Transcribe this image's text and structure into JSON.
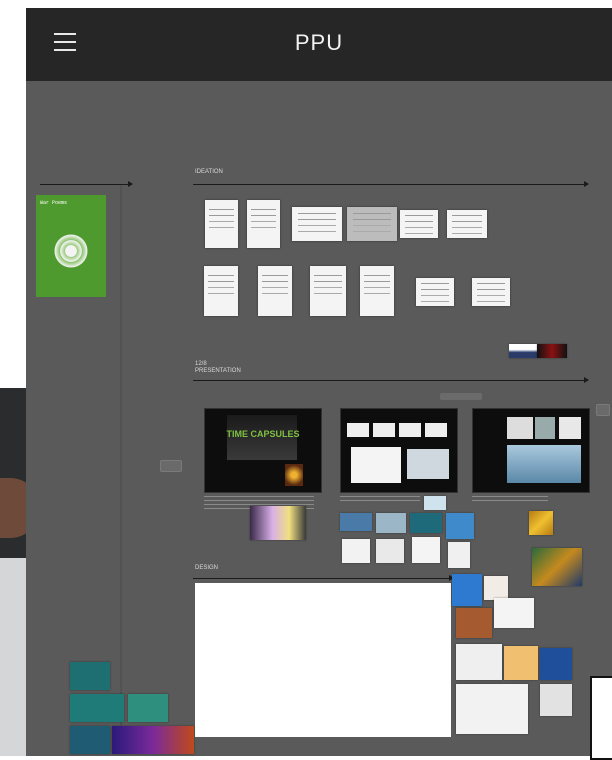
{
  "header": {
    "title": "PPU",
    "menu_icon": "hamburger-menu-icon"
  },
  "sections": {
    "ideation": "IDEATION",
    "presentation": "12/8\nPRESENTATION",
    "design": "DESIGN"
  },
  "poster": {
    "label": "War Poems"
  },
  "slides": [
    {
      "title": "TIME CAPSULES"
    },
    {
      "title": ""
    },
    {
      "title": ""
    }
  ],
  "colors": {
    "topbar": "#262626",
    "canvas": "#5a5a5a",
    "poster_green": "#4f9a2e",
    "slide_title_green": "#7fc142"
  }
}
